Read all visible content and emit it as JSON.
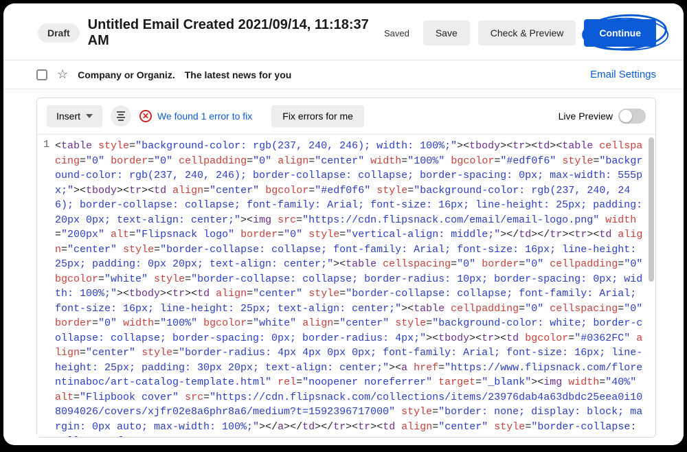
{
  "header": {
    "draft_badge": "Draft",
    "title": "Untitled Email Created 2021/09/14, 11:18:37 AM",
    "saved": "Saved",
    "save": "Save",
    "check_preview": "Check & Preview",
    "continue": "Continue"
  },
  "subject_row": {
    "sender": "Company or Organiz.",
    "subject": "The latest news for you",
    "settings": "Email Settings"
  },
  "toolbar": {
    "insert": "Insert",
    "error_text": "We found 1 error to fix",
    "fix_label": "Fix errors for me",
    "live_preview": "Live Preview"
  },
  "code": {
    "line_number": "1",
    "tokens": [
      {
        "c": "t-punc",
        "t": "<"
      },
      {
        "c": "t-tag",
        "t": "table"
      },
      {
        "c": "t-punc",
        "t": " "
      },
      {
        "c": "t-attr",
        "t": "style"
      },
      {
        "c": "t-punc",
        "t": "="
      },
      {
        "c": "t-val",
        "t": "\"background-color: rgb(237, 240, 246); width: 100%;\""
      },
      {
        "c": "t-punc",
        "t": "><"
      },
      {
        "c": "t-tag",
        "t": "tbody"
      },
      {
        "c": "t-punc",
        "t": "><"
      },
      {
        "c": "t-tag",
        "t": "tr"
      },
      {
        "c": "t-punc",
        "t": "><"
      },
      {
        "c": "t-tag",
        "t": "td"
      },
      {
        "c": "t-punc",
        "t": "><"
      },
      {
        "c": "t-tag",
        "t": "table"
      },
      {
        "c": "t-punc",
        "t": " "
      },
      {
        "c": "t-attr",
        "t": "cellspacing"
      },
      {
        "c": "t-punc",
        "t": "="
      },
      {
        "c": "t-val",
        "t": "\"0\""
      },
      {
        "c": "t-punc",
        "t": " "
      },
      {
        "c": "t-attr",
        "t": "border"
      },
      {
        "c": "t-punc",
        "t": "="
      },
      {
        "c": "t-val",
        "t": "\"0\""
      },
      {
        "c": "t-punc",
        "t": " "
      },
      {
        "c": "t-attr",
        "t": "cellpadding"
      },
      {
        "c": "t-punc",
        "t": "="
      },
      {
        "c": "t-val",
        "t": "\"0\""
      },
      {
        "c": "t-punc",
        "t": " "
      },
      {
        "c": "t-attr",
        "t": "align"
      },
      {
        "c": "t-punc",
        "t": "="
      },
      {
        "c": "t-val",
        "t": "\"center\""
      },
      {
        "c": "t-punc",
        "t": " "
      },
      {
        "c": "t-attr",
        "t": "width"
      },
      {
        "c": "t-punc",
        "t": "="
      },
      {
        "c": "t-val",
        "t": "\"100%\""
      },
      {
        "c": "t-punc",
        "t": " "
      },
      {
        "c": "t-attr",
        "t": "bgcolor"
      },
      {
        "c": "t-punc",
        "t": "="
      },
      {
        "c": "t-val",
        "t": "\"#edf0f6\""
      },
      {
        "c": "t-punc",
        "t": " "
      },
      {
        "c": "t-attr",
        "t": "style"
      },
      {
        "c": "t-punc",
        "t": "="
      },
      {
        "c": "t-val",
        "t": "\"background-color: rgb(237, 240, 246); border-collapse: collapse; border-spacing: 0px; max-width: 555px;\""
      },
      {
        "c": "t-punc",
        "t": "><"
      },
      {
        "c": "t-tag",
        "t": "tbody"
      },
      {
        "c": "t-punc",
        "t": "><"
      },
      {
        "c": "t-tag",
        "t": "tr"
      },
      {
        "c": "t-punc",
        "t": "><"
      },
      {
        "c": "t-tag",
        "t": "td"
      },
      {
        "c": "t-punc",
        "t": " "
      },
      {
        "c": "t-attr",
        "t": "align"
      },
      {
        "c": "t-punc",
        "t": "="
      },
      {
        "c": "t-val",
        "t": "\"center\""
      },
      {
        "c": "t-punc",
        "t": " "
      },
      {
        "c": "t-attr",
        "t": "bgcolor"
      },
      {
        "c": "t-punc",
        "t": "="
      },
      {
        "c": "t-val",
        "t": "\"#edf0f6\""
      },
      {
        "c": "t-punc",
        "t": " "
      },
      {
        "c": "t-attr",
        "t": "style"
      },
      {
        "c": "t-punc",
        "t": "="
      },
      {
        "c": "t-val",
        "t": "\"background-color: rgb(237, 240, 246); border-collapse: collapse; font-family: Arial; font-size: 16px; line-height: 25px; padding: 20px 0px; text-align: center;\""
      },
      {
        "c": "t-punc",
        "t": "><"
      },
      {
        "c": "t-tag",
        "t": "img"
      },
      {
        "c": "t-punc",
        "t": " "
      },
      {
        "c": "t-attr",
        "t": "src"
      },
      {
        "c": "t-punc",
        "t": "="
      },
      {
        "c": "t-val",
        "t": "\"https://cdn.flipsnack.com/email/email-logo.png\""
      },
      {
        "c": "t-punc",
        "t": " "
      },
      {
        "c": "t-attr",
        "t": "width"
      },
      {
        "c": "t-punc",
        "t": "="
      },
      {
        "c": "t-val",
        "t": "\"200px\""
      },
      {
        "c": "t-punc",
        "t": " "
      },
      {
        "c": "t-attr",
        "t": "alt"
      },
      {
        "c": "t-punc",
        "t": "="
      },
      {
        "c": "t-val",
        "t": "\"Flipsnack logo\""
      },
      {
        "c": "t-punc",
        "t": " "
      },
      {
        "c": "t-attr",
        "t": "border"
      },
      {
        "c": "t-punc",
        "t": "="
      },
      {
        "c": "t-val",
        "t": "\"0\""
      },
      {
        "c": "t-punc",
        "t": " "
      },
      {
        "c": "t-attr",
        "t": "style"
      },
      {
        "c": "t-punc",
        "t": "="
      },
      {
        "c": "t-val",
        "t": "\"vertical-align: middle;\""
      },
      {
        "c": "t-punc",
        "t": "></"
      },
      {
        "c": "t-tag",
        "t": "td"
      },
      {
        "c": "t-punc",
        "t": "></"
      },
      {
        "c": "t-tag",
        "t": "tr"
      },
      {
        "c": "t-punc",
        "t": "><"
      },
      {
        "c": "t-tag",
        "t": "tr"
      },
      {
        "c": "t-punc",
        "t": "><"
      },
      {
        "c": "t-tag",
        "t": "td"
      },
      {
        "c": "t-punc",
        "t": " "
      },
      {
        "c": "t-attr",
        "t": "align"
      },
      {
        "c": "t-punc",
        "t": "="
      },
      {
        "c": "t-val",
        "t": "\"center\""
      },
      {
        "c": "t-punc",
        "t": " "
      },
      {
        "c": "t-attr",
        "t": "style"
      },
      {
        "c": "t-punc",
        "t": "="
      },
      {
        "c": "t-val",
        "t": "\"border-collapse: collapse; font-family: Arial; font-size: 16px; line-height: 25px; padding: 0px 20px; text-align: center;\""
      },
      {
        "c": "t-punc",
        "t": "><"
      },
      {
        "c": "t-tag",
        "t": "table"
      },
      {
        "c": "t-punc",
        "t": " "
      },
      {
        "c": "t-attr",
        "t": "cellspacing"
      },
      {
        "c": "t-punc",
        "t": "="
      },
      {
        "c": "t-val",
        "t": "\"0\""
      },
      {
        "c": "t-punc",
        "t": " "
      },
      {
        "c": "t-attr",
        "t": "border"
      },
      {
        "c": "t-punc",
        "t": "="
      },
      {
        "c": "t-val",
        "t": "\"0\""
      },
      {
        "c": "t-punc",
        "t": " "
      },
      {
        "c": "t-attr",
        "t": "cellpadding"
      },
      {
        "c": "t-punc",
        "t": "="
      },
      {
        "c": "t-val",
        "t": "\"0\""
      },
      {
        "c": "t-punc",
        "t": " "
      },
      {
        "c": "t-attr",
        "t": "bgcolor"
      },
      {
        "c": "t-punc",
        "t": "="
      },
      {
        "c": "t-val",
        "t": "\"white\""
      },
      {
        "c": "t-punc",
        "t": " "
      },
      {
        "c": "t-attr",
        "t": "style"
      },
      {
        "c": "t-punc",
        "t": "="
      },
      {
        "c": "t-val",
        "t": "\"border-collapse: collapse; border-radius: 10px; border-spacing: 0px; width: 100%;\""
      },
      {
        "c": "t-punc",
        "t": "><"
      },
      {
        "c": "t-tag",
        "t": "tbody"
      },
      {
        "c": "t-punc",
        "t": "><"
      },
      {
        "c": "t-tag",
        "t": "tr"
      },
      {
        "c": "t-punc",
        "t": "><"
      },
      {
        "c": "t-tag",
        "t": "td"
      },
      {
        "c": "t-punc",
        "t": " "
      },
      {
        "c": "t-attr",
        "t": "align"
      },
      {
        "c": "t-punc",
        "t": "="
      },
      {
        "c": "t-val",
        "t": "\"center\""
      },
      {
        "c": "t-punc",
        "t": " "
      },
      {
        "c": "t-attr",
        "t": "style"
      },
      {
        "c": "t-punc",
        "t": "="
      },
      {
        "c": "t-val",
        "t": "\"border-collapse: collapse; font-family: Arial; font-size: 16px; line-height: 25px; text-align: center;\""
      },
      {
        "c": "t-punc",
        "t": "><"
      },
      {
        "c": "t-tag",
        "t": "table"
      },
      {
        "c": "t-punc",
        "t": " "
      },
      {
        "c": "t-attr",
        "t": "cellpadding"
      },
      {
        "c": "t-punc",
        "t": "="
      },
      {
        "c": "t-val",
        "t": "\"0\""
      },
      {
        "c": "t-punc",
        "t": " "
      },
      {
        "c": "t-attr",
        "t": "cellspacing"
      },
      {
        "c": "t-punc",
        "t": "="
      },
      {
        "c": "t-val",
        "t": "\"0\""
      },
      {
        "c": "t-punc",
        "t": " "
      },
      {
        "c": "t-attr",
        "t": "border"
      },
      {
        "c": "t-punc",
        "t": "="
      },
      {
        "c": "t-val",
        "t": "\"0\""
      },
      {
        "c": "t-punc",
        "t": " "
      },
      {
        "c": "t-attr",
        "t": "width"
      },
      {
        "c": "t-punc",
        "t": "="
      },
      {
        "c": "t-val",
        "t": "\"100%\""
      },
      {
        "c": "t-punc",
        "t": " "
      },
      {
        "c": "t-attr",
        "t": "bgcolor"
      },
      {
        "c": "t-punc",
        "t": "="
      },
      {
        "c": "t-val",
        "t": "\"white\""
      },
      {
        "c": "t-punc",
        "t": " "
      },
      {
        "c": "t-attr",
        "t": "align"
      },
      {
        "c": "t-punc",
        "t": "="
      },
      {
        "c": "t-val",
        "t": "\"center\""
      },
      {
        "c": "t-punc",
        "t": " "
      },
      {
        "c": "t-attr",
        "t": "style"
      },
      {
        "c": "t-punc",
        "t": "="
      },
      {
        "c": "t-val",
        "t": "\"background-color: white; border-collapse: collapse; border-spacing: 0px; border-radius: 4px;\""
      },
      {
        "c": "t-punc",
        "t": "><"
      },
      {
        "c": "t-tag",
        "t": "tbody"
      },
      {
        "c": "t-punc",
        "t": "><"
      },
      {
        "c": "t-tag",
        "t": "tr"
      },
      {
        "c": "t-punc",
        "t": "><"
      },
      {
        "c": "t-tag",
        "t": "td"
      },
      {
        "c": "t-punc",
        "t": " "
      },
      {
        "c": "t-attr",
        "t": "bgcolor"
      },
      {
        "c": "t-punc",
        "t": "="
      },
      {
        "c": "t-val",
        "t": "\"#0362FC\""
      },
      {
        "c": "t-punc",
        "t": " "
      },
      {
        "c": "t-attr",
        "t": "align"
      },
      {
        "c": "t-punc",
        "t": "="
      },
      {
        "c": "t-val",
        "t": "\"center\""
      },
      {
        "c": "t-punc",
        "t": " "
      },
      {
        "c": "t-attr",
        "t": "style"
      },
      {
        "c": "t-punc",
        "t": "="
      },
      {
        "c": "t-val",
        "t": "\"border-radius: 4px 4px 0px 0px; font-family: Arial; font-size: 16px; line-height: 25px; padding: 30px 20px; text-align: center;\""
      },
      {
        "c": "t-punc",
        "t": "><"
      },
      {
        "c": "t-tag",
        "t": "a"
      },
      {
        "c": "t-punc",
        "t": " "
      },
      {
        "c": "t-attr",
        "t": "href"
      },
      {
        "c": "t-punc",
        "t": "="
      },
      {
        "c": "t-val",
        "t": "\"https://www.flipsnack.com/florentinaboc/art-catalog-template.html\""
      },
      {
        "c": "t-punc",
        "t": " "
      },
      {
        "c": "t-attr",
        "t": "rel"
      },
      {
        "c": "t-punc",
        "t": "="
      },
      {
        "c": "t-val",
        "t": "\"noopener noreferrer\""
      },
      {
        "c": "t-punc",
        "t": " "
      },
      {
        "c": "t-attr",
        "t": "target"
      },
      {
        "c": "t-punc",
        "t": "="
      },
      {
        "c": "t-val",
        "t": "\"_blank\""
      },
      {
        "c": "t-punc",
        "t": "><"
      },
      {
        "c": "t-tag",
        "t": "img"
      },
      {
        "c": "t-punc",
        "t": " "
      },
      {
        "c": "t-attr",
        "t": "width"
      },
      {
        "c": "t-punc",
        "t": "="
      },
      {
        "c": "t-val",
        "t": "\"40%\""
      },
      {
        "c": "t-punc",
        "t": " "
      },
      {
        "c": "t-attr",
        "t": "alt"
      },
      {
        "c": "t-punc",
        "t": "="
      },
      {
        "c": "t-val",
        "t": "\"Flipbook cover\""
      },
      {
        "c": "t-punc",
        "t": " "
      },
      {
        "c": "t-attr",
        "t": "src"
      },
      {
        "c": "t-punc",
        "t": "="
      },
      {
        "c": "t-val",
        "t": "\"https://cdn.flipsnack.com/collections/items/23976dab4a63dbdc25eea0i108094026/covers/xjfr02e8a6phr8a6/medium?t=1592396717000\""
      },
      {
        "c": "t-punc",
        "t": " "
      },
      {
        "c": "t-attr",
        "t": "style"
      },
      {
        "c": "t-punc",
        "t": "="
      },
      {
        "c": "t-val",
        "t": "\"border: none; display: block; margin: 0px auto; max-width: 100%;\""
      },
      {
        "c": "t-punc",
        "t": "></"
      },
      {
        "c": "t-tag",
        "t": "a"
      },
      {
        "c": "t-punc",
        "t": "></"
      },
      {
        "c": "t-tag",
        "t": "td"
      },
      {
        "c": "t-punc",
        "t": "></"
      },
      {
        "c": "t-tag",
        "t": "tr"
      },
      {
        "c": "t-punc",
        "t": "><"
      },
      {
        "c": "t-tag",
        "t": "tr"
      },
      {
        "c": "t-punc",
        "t": "><"
      },
      {
        "c": "t-tag",
        "t": "td"
      },
      {
        "c": "t-punc",
        "t": " "
      },
      {
        "c": "t-attr",
        "t": "align"
      },
      {
        "c": "t-punc",
        "t": "="
      },
      {
        "c": "t-val",
        "t": "\"center\""
      },
      {
        "c": "t-punc",
        "t": " "
      },
      {
        "c": "t-attr",
        "t": "style"
      },
      {
        "c": "t-punc",
        "t": "="
      },
      {
        "c": "t-val",
        "t": "\"border-collapse: collapse; font-"
      }
    ]
  }
}
